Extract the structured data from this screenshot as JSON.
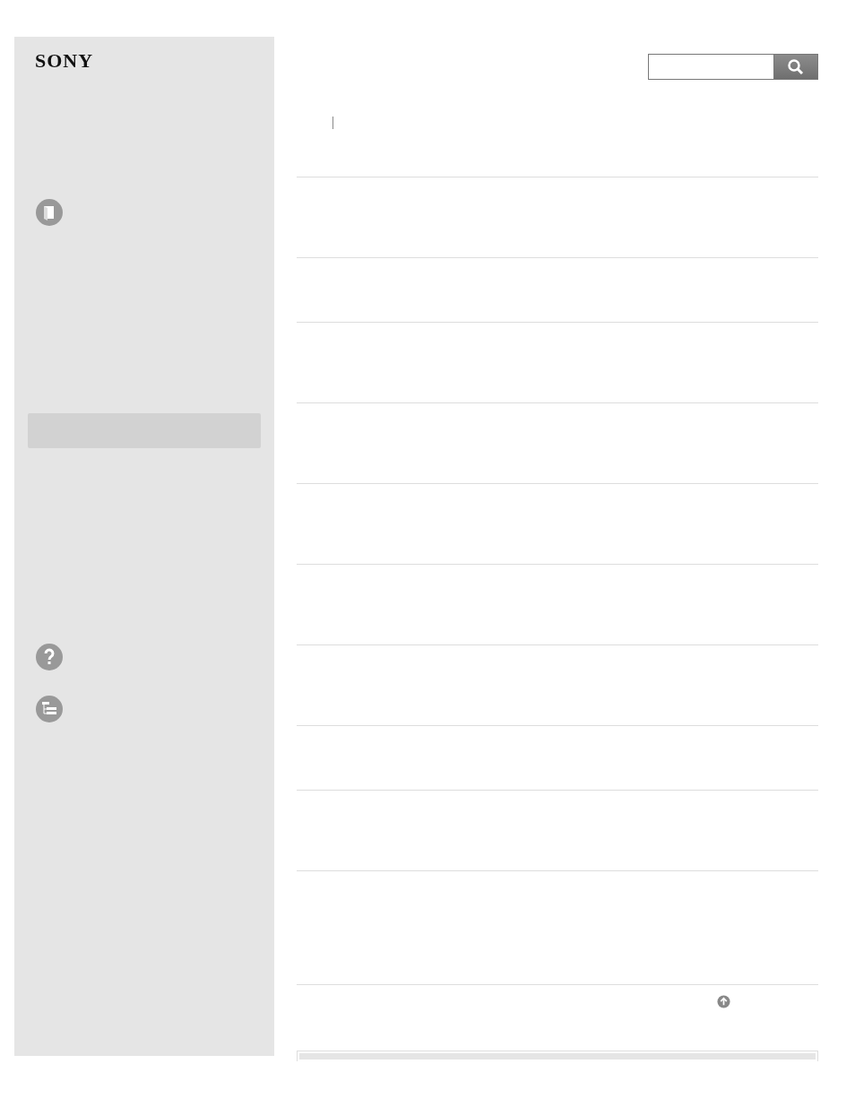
{
  "brand": {
    "logo": "SONY"
  },
  "sidebar": {
    "items": [
      {
        "selected": true
      }
    ]
  }
}
